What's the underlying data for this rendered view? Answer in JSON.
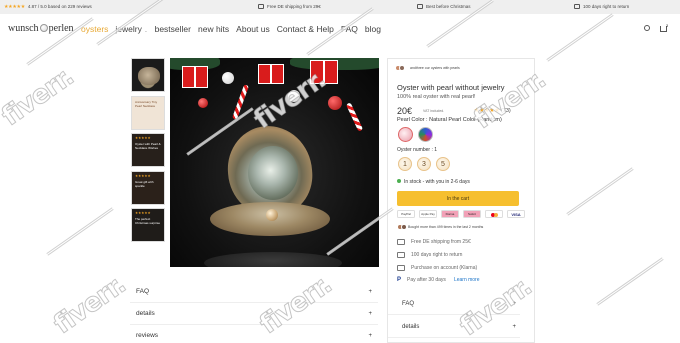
{
  "topbar": {
    "rating_stars": "★★★★★",
    "rating_text": "4.87 / 5.0 based on 229 reviews",
    "shipping": "Free DE shipping from 29€",
    "christmas": "Best before Christmas",
    "returns": "100 days right to return"
  },
  "header": {
    "logo": {
      "left": "wunsch",
      "right": "perlen"
    },
    "nav": [
      "oysters",
      "jewelry",
      "bestseller",
      "new hits",
      "About us",
      "Contact & Help",
      "FAQ",
      "blog"
    ],
    "nav_caret": "⌄",
    "cart_count": "3"
  },
  "gallery": {
    "thumb2_text": "Anniversary Tiny Pearl Necklace",
    "thumb3_text": "Oyster with Pearl & Necklace Wishes",
    "thumb4_text": "Great gift with sparkle",
    "thumb5_text": "The perfect Christmas surprise"
  },
  "product": {
    "viewing": "andthree our oysters with pearls",
    "title": "Oyster with pearl without jewelry",
    "subtitle": "100% real oyster with real pearl!",
    "price": "20€",
    "vat": "VAT included.",
    "rating_stars": "★★★★★",
    "rating_count": "(73)",
    "color_label": "Pearl Color : Natural Pearl Color (Random)",
    "number_label": "Oyster number : 1",
    "numbers": [
      "1",
      "3",
      "5"
    ],
    "stock": "In stock - with you in 2-6 days",
    "cart_button": "In the cart",
    "payments": [
      "PayPal",
      "Apple Pay",
      "Klarna",
      "Sofort",
      "",
      "VISA"
    ],
    "bought": "Bought more than 499 times in the last 2 months",
    "features": [
      {
        "text": "Free DE shipping from 25€",
        "link": ""
      },
      {
        "text": "100 days right to return",
        "link": ""
      },
      {
        "text": "Purchase on account (Klarna)",
        "link": ""
      },
      {
        "text": "Pay after 30 days",
        "link": "Learn more"
      }
    ],
    "paypal_mark": "P",
    "right_accordion": [
      "FAQ",
      "details"
    ]
  },
  "accordion": [
    "FAQ",
    "details",
    "reviews"
  ],
  "accordion_plus": "+",
  "watermark": "fiverr.",
  "colors": {
    "accent": "#e8a935",
    "cart_button": "#f6bf2f",
    "stock_dot": "#4caf50",
    "stars": "#f5a623"
  }
}
